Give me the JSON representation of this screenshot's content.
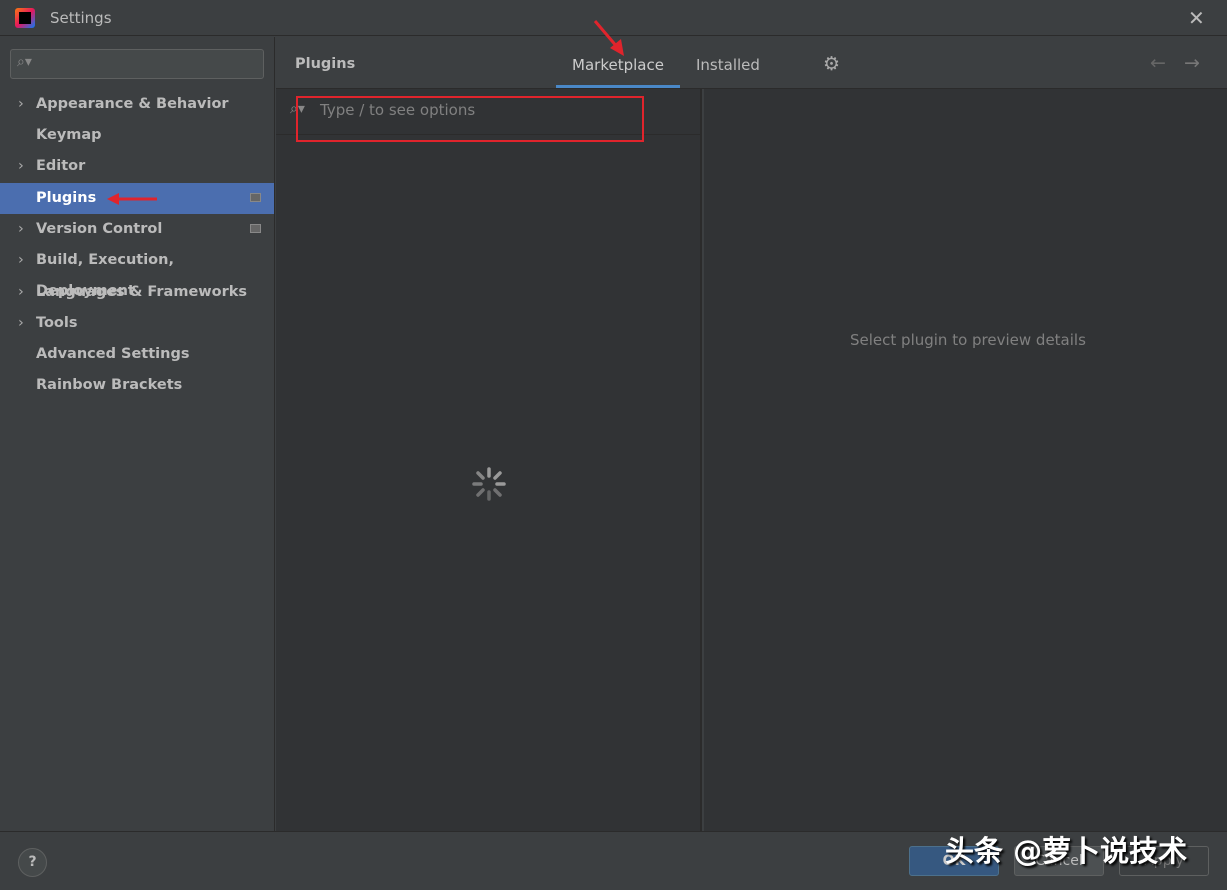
{
  "window": {
    "title": "Settings",
    "close": "✕"
  },
  "sidebar": {
    "search_placeholder": "",
    "items": [
      {
        "label": "Appearance & Behavior",
        "expandable": true
      },
      {
        "label": "Keymap",
        "expandable": false
      },
      {
        "label": "Editor",
        "expandable": true
      },
      {
        "label": "Plugins",
        "expandable": false,
        "selected": true
      },
      {
        "label": "Version Control",
        "expandable": true
      },
      {
        "label": "Build, Execution, Deployment",
        "expandable": true
      },
      {
        "label": "Languages & Frameworks",
        "expandable": true
      },
      {
        "label": "Tools",
        "expandable": true
      },
      {
        "label": "Advanced Settings",
        "expandable": false
      },
      {
        "label": "Rainbow Brackets",
        "expandable": false
      }
    ]
  },
  "main": {
    "title": "Plugins",
    "tabs": [
      {
        "label": "Marketplace",
        "active": true
      },
      {
        "label": "Installed",
        "active": false
      }
    ],
    "search_placeholder": "Type / to see options",
    "preview_message": "Select plugin to preview details"
  },
  "footer": {
    "help": "?",
    "ok": "OK",
    "cancel": "Cancel",
    "apply": "Apply"
  },
  "watermark": "头条 @萝卜说技术",
  "colors": {
    "selection": "#4b6eaf",
    "tab_underline": "#4a88c7",
    "annotation": "#e0242c"
  }
}
